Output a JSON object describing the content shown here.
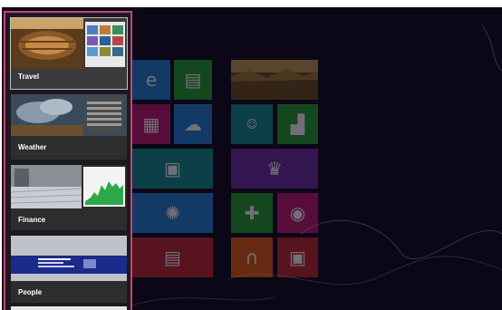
{
  "switcher": {
    "apps": [
      {
        "label": "Travel",
        "selected": true
      },
      {
        "label": "Weather",
        "selected": false
      },
      {
        "label": "Finance",
        "selected": false
      },
      {
        "label": "People",
        "selected": false
      },
      {
        "label": "",
        "selected": false
      }
    ],
    "border_color": "#c8417a"
  },
  "start_screen": {
    "tiles": [
      {
        "name": "ie-tile",
        "icon": "internet-explorer-icon",
        "color": "#1e7fd4"
      },
      {
        "name": "store-tile",
        "icon": "store-icon",
        "color": "#1fa02a"
      },
      {
        "name": "photos-tile",
        "icon": "photos-icon",
        "color": "#c0176d"
      },
      {
        "name": "skydrive-tile",
        "icon": "cloud-icon",
        "color": "#1e7fd4"
      },
      {
        "name": "pictures-tile",
        "icon": "picture-icon",
        "color": "#0e8c8c"
      },
      {
        "name": "weather-tile",
        "icon": "sun-icon",
        "color": "#1e7fd4"
      },
      {
        "name": "news-tile",
        "icon": "news-icon",
        "color": "#c0272d"
      },
      {
        "name": "travel-live-tile",
        "icon": "landscape-image",
        "color": "#8a6d2a"
      },
      {
        "name": "people-live-tile",
        "icon": "people-icon",
        "color": "#0e8c8c"
      },
      {
        "name": "finance-live-tile",
        "icon": "chart-icon",
        "color": "#1fa02a"
      },
      {
        "name": "games-trophy-tile",
        "icon": "trophy-icon",
        "color": "#6a2aa0"
      },
      {
        "name": "xbox-games-tile",
        "icon": "gamepad-icon",
        "color": "#1fa02a"
      },
      {
        "name": "camera-tile",
        "icon": "camera-icon",
        "color": "#c0176d"
      },
      {
        "name": "music-tile",
        "icon": "headphones-icon",
        "color": "#e25a0e"
      },
      {
        "name": "video-tile",
        "icon": "video-icon",
        "color": "#c0272d"
      }
    ]
  }
}
